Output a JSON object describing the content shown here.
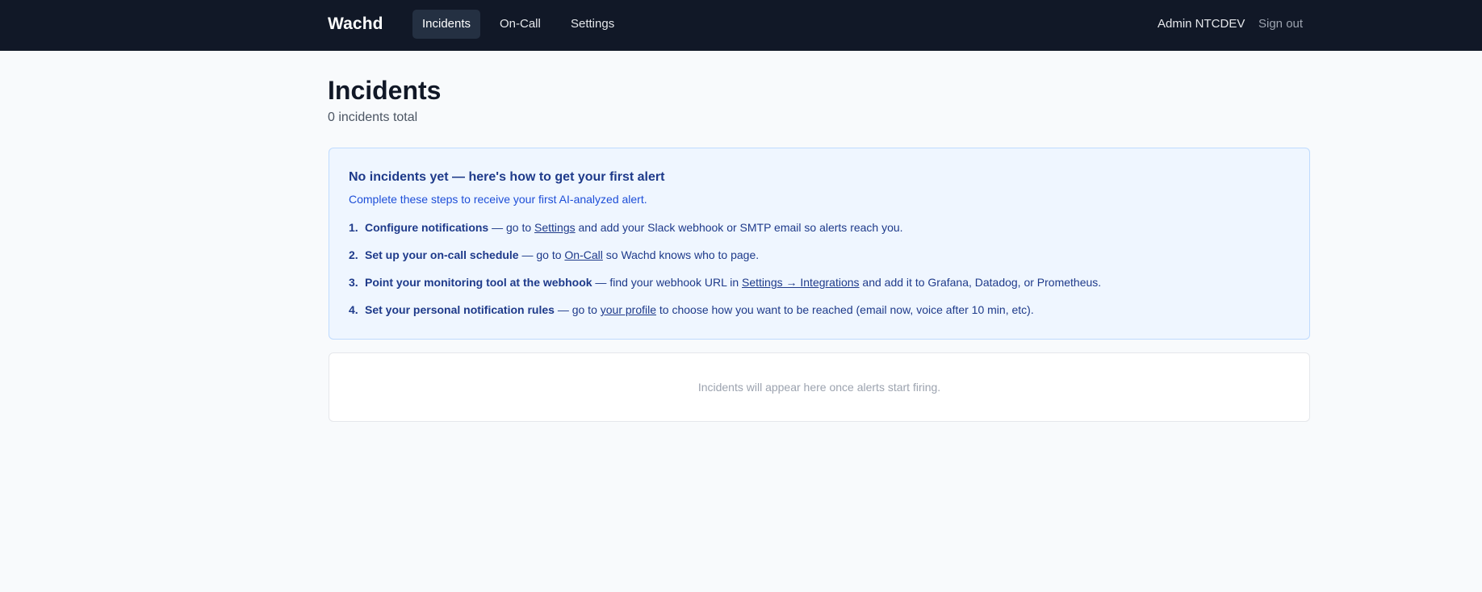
{
  "nav": {
    "brand": "Wachd",
    "items": [
      {
        "label": "Incidents",
        "active": true
      },
      {
        "label": "On-Call",
        "active": false
      },
      {
        "label": "Settings",
        "active": false
      }
    ],
    "user_name": "Admin NTCDEV",
    "sign_out": "Sign out"
  },
  "page": {
    "title": "Incidents",
    "subtitle": "0 incidents total"
  },
  "onboarding": {
    "title": "No incidents yet — here's how to get your first alert",
    "description": "Complete these steps to receive your first AI-analyzed alert.",
    "steps": [
      {
        "num": "1.",
        "bold": "Configure notifications",
        "pre": " — go to ",
        "link": "Settings",
        "post": " and add your Slack webhook or SMTP email so alerts reach you."
      },
      {
        "num": "2.",
        "bold": "Set up your on-call schedule",
        "pre": " — go to ",
        "link": "On-Call",
        "post": " so Wachd knows who to page."
      },
      {
        "num": "3.",
        "bold": "Point your monitoring tool at the webhook",
        "pre": " — find your webhook URL in ",
        "link": "Settings → Integrations",
        "post": " and add it to Grafana, Datadog, or Prometheus."
      },
      {
        "num": "4.",
        "bold": "Set your personal notification rules",
        "pre": " — go to ",
        "link": "your profile",
        "post": " to choose how you want to be reached (email now, voice after 10 min, etc)."
      }
    ]
  },
  "empty_state": {
    "text": "Incidents will appear here once alerts start firing."
  },
  "colors": {
    "topbar": "#111827",
    "accent_text": "#1e3a8a",
    "info_bg": "#eff6ff",
    "info_border": "#bfdbfe"
  }
}
